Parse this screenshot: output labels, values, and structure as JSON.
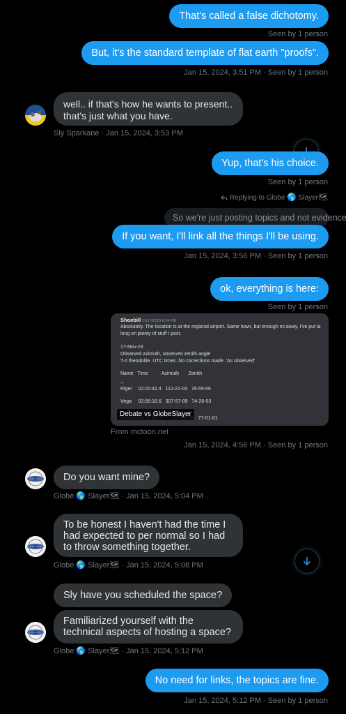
{
  "messages": {
    "m1": "That's called a false dichotomy.",
    "m1_meta": "Seen by 1 person",
    "m2": "But, it's the standard template of flat earth \"proofs\".",
    "m2_meta": "Jan 15, 2024, 3:51 PM · Seen by 1 person",
    "m3": "well.. if that's how he wants to present.. that's just what you have.",
    "m3_meta": "Sly Sparkane · Jan 15, 2024, 3:53 PM",
    "m4": "Yup, that's his choice.",
    "m4_meta": "Seen by 1 person",
    "reply_label": "Replying to Globe",
    "reply_label_tail": "Slayer",
    "quoted": "So we're just posting topics and not evidence?",
    "m5": "If you want, I'll link all the things I'll be using.",
    "m5_meta": "Jan 15, 2024, 3:56 PM · Seen by 1 person",
    "m6": "ok, everything is here:",
    "m6_meta": "Seen by 1 person",
    "card": {
      "author": "Shoebill",
      "author_date": "11/17/2023 8:34 PM",
      "line1": "Absolutely. The location is at the regional airport. Same town, but enough mi away. I've put la",
      "line2": "long on plenty of stuff I post.",
      "line3": "17-Nov-23",
      "line4": "Observed azimuth, observed zenith angle",
      "line5": "T-2 theodolite. UTC times. No corrections made. 'As observed'",
      "header": "Name   Time          Azimuth       Zenith",
      "dash": "--",
      "row1": "Rigel     02:20:42.4   112-21-03   76-59-56",
      "row2": "Vega     02:56:18.6   307-57-09   74-26-03",
      "row3": "Fomalhaut 02:52:20.7   212-05-35   77-01-01",
      "caption": "Debate vs GlobeSlayer",
      "source": "From mctoon.net"
    },
    "card_meta": "Jan 15, 2024, 4:56 PM · Seen by 1 person",
    "m7": "Do you want mine?",
    "m7_meta_name": "Globe",
    "m7_meta_tail": "Slayer",
    "m7_meta_time": " · Jan 15, 2024, 5:04 PM",
    "m8": "To be honest I haven't had the time I had expected to per normal so I had to throw something together.",
    "m8_meta_time": " · Jan 15, 2024, 5:08 PM",
    "m9": "Sly have you scheduled the space?",
    "m10": "Familiarized yourself with the technical aspects of hosting a space?",
    "m10_meta_time": " · Jan 15, 2024, 5:12 PM",
    "m11": "No need for links, the topics are fine.",
    "m11_meta": "Jan 15, 2024, 5:12 PM · Seen by 1 person"
  },
  "icons": {
    "scroll_down": "arrow-down-icon",
    "reply": "reply-arrow-icon",
    "globe": "globe-emoji-icon",
    "map": "map-emoji-icon"
  },
  "colors": {
    "accent": "#1d9bf0",
    "incoming": "#2f3336",
    "muted": "#71767b"
  }
}
